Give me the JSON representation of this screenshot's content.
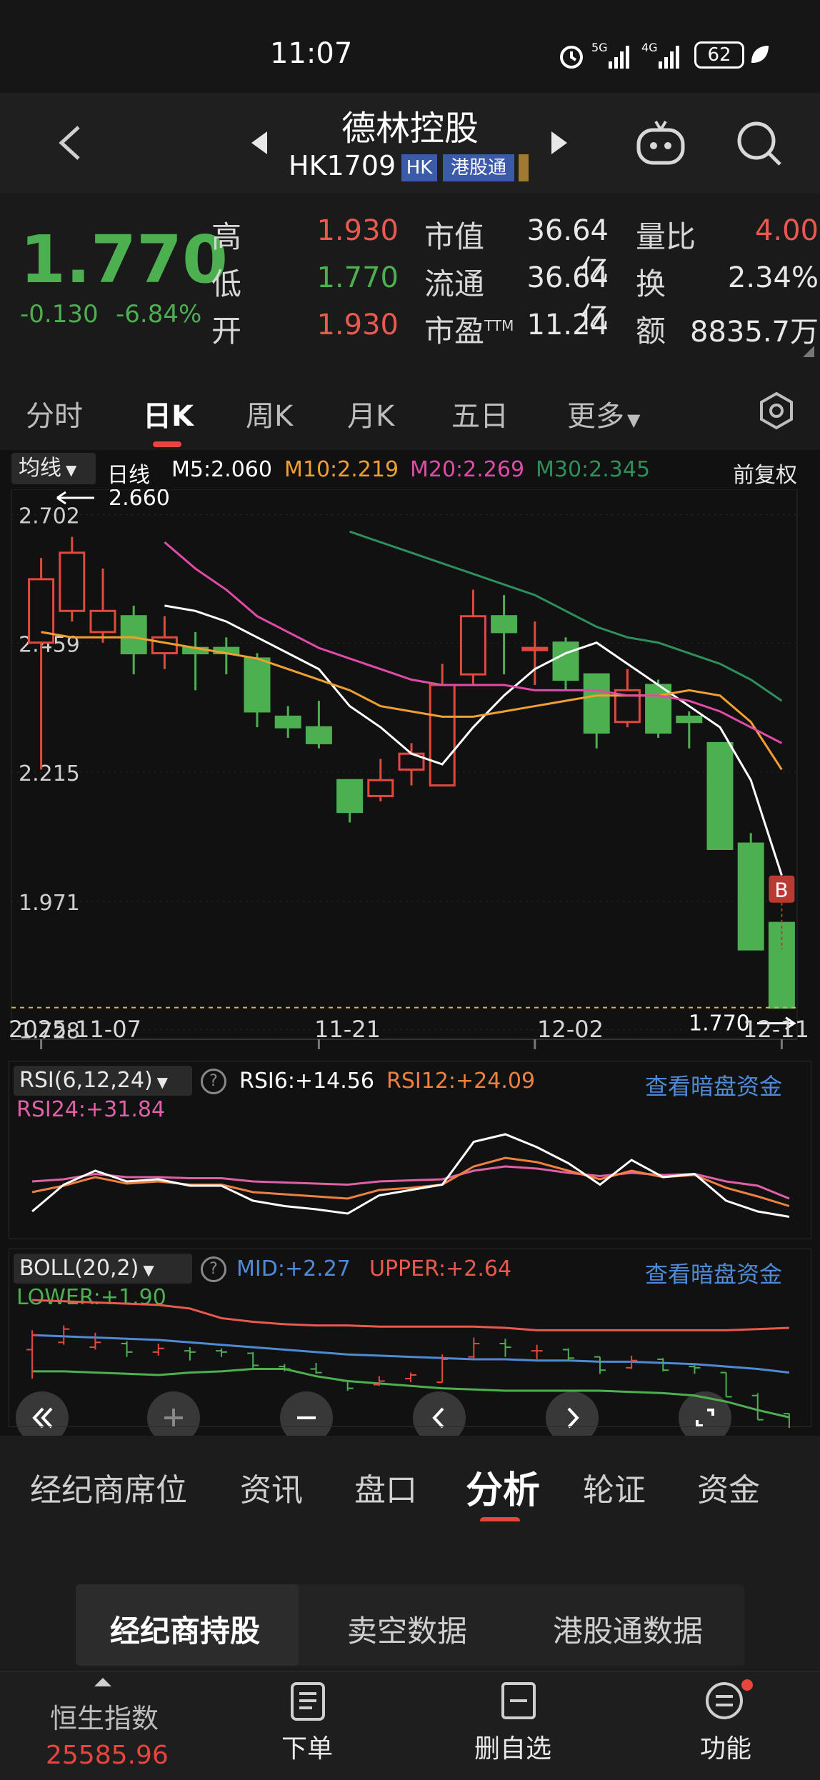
{
  "status": {
    "time": "11:07",
    "battery": "62",
    "net1": "5G",
    "net2": "4G"
  },
  "header": {
    "name": "德林控股",
    "code": "HK1709",
    "badge_hk": "HK",
    "badge_connect": "港股通"
  },
  "quote": {
    "price": "1.770",
    "change": "-0.130",
    "change_pct": "-6.84%",
    "high_label": "高",
    "high": "1.930",
    "low_label": "低",
    "low": "1.770",
    "open_label": "开",
    "open": "1.930",
    "mcap_label": "市值",
    "mcap": "36.64亿",
    "float_label": "流通",
    "float": "36.64亿",
    "pe_label": "市盈",
    "pe_sup": "TTM",
    "pe": "11.24",
    "vr_label": "量比",
    "vr": "4.00",
    "turnover_label": "换",
    "turnover": "2.34%",
    "amount_label": "额",
    "amount": "8835.7万"
  },
  "tabs": {
    "t1": "分时",
    "t2": "日K",
    "t3": "周K",
    "t4": "月K",
    "t5": "五日",
    "t6": "更多"
  },
  "ma_bar": {
    "select": "均线",
    "period": "日线",
    "m5": "M5:2.060",
    "m10": "M10:2.219",
    "m20": "M20:2.269",
    "m30": "M30:2.345",
    "adjust": "前复权"
  },
  "kline": {
    "y_ticks": [
      "2.702",
      "2.459",
      "2.215",
      "1.971",
      "1.728"
    ],
    "y_values": [
      2.702,
      2.459,
      2.215,
      1.971,
      1.728
    ],
    "max_label": "2.660",
    "last_label": "1.770",
    "x_labels": [
      "2025-11-07",
      "11-21",
      "12-02",
      "12-11"
    ],
    "buy_marker": "B",
    "candles": [
      {
        "o": 2.46,
        "c": 2.58,
        "h": 2.62,
        "l": 2.22
      },
      {
        "o": 2.52,
        "c": 2.63,
        "h": 2.66,
        "l": 2.5
      },
      {
        "o": 2.48,
        "c": 2.52,
        "h": 2.6,
        "l": 2.46
      },
      {
        "o": 2.51,
        "c": 2.44,
        "h": 2.53,
        "l": 2.4
      },
      {
        "o": 2.44,
        "c": 2.47,
        "h": 2.51,
        "l": 2.41
      },
      {
        "o": 2.45,
        "c": 2.44,
        "h": 2.48,
        "l": 2.37
      },
      {
        "o": 2.45,
        "c": 2.44,
        "h": 2.47,
        "l": 2.4
      },
      {
        "o": 2.43,
        "c": 2.33,
        "h": 2.44,
        "l": 2.3
      },
      {
        "o": 2.32,
        "c": 2.3,
        "h": 2.34,
        "l": 2.28
      },
      {
        "o": 2.3,
        "c": 2.27,
        "h": 2.35,
        "l": 2.26
      },
      {
        "o": 2.2,
        "c": 2.14,
        "h": 2.2,
        "l": 2.12
      },
      {
        "o": 2.17,
        "c": 2.2,
        "h": 2.24,
        "l": 2.16
      },
      {
        "o": 2.22,
        "c": 2.25,
        "h": 2.27,
        "l": 2.19
      },
      {
        "o": 2.19,
        "c": 2.38,
        "h": 2.42,
        "l": 2.19
      },
      {
        "o": 2.4,
        "c": 2.51,
        "h": 2.56,
        "l": 2.38
      },
      {
        "o": 2.51,
        "c": 2.48,
        "h": 2.55,
        "l": 2.4
      },
      {
        "o": 2.45,
        "c": 2.45,
        "h": 2.5,
        "l": 2.38
      },
      {
        "o": 2.46,
        "c": 2.39,
        "h": 2.47,
        "l": 2.37
      },
      {
        "o": 2.4,
        "c": 2.29,
        "h": 2.4,
        "l": 2.26
      },
      {
        "o": 2.31,
        "c": 2.37,
        "h": 2.41,
        "l": 2.3
      },
      {
        "o": 2.38,
        "c": 2.29,
        "h": 2.39,
        "l": 2.28
      },
      {
        "o": 2.32,
        "c": 2.31,
        "h": 2.33,
        "l": 2.26
      },
      {
        "o": 2.27,
        "c": 2.07,
        "h": 2.27,
        "l": 2.07
      },
      {
        "o": 2.08,
        "c": 1.88,
        "h": 2.1,
        "l": 1.88
      },
      {
        "o": 1.93,
        "c": 1.77,
        "h": 1.93,
        "l": 1.77
      }
    ],
    "ma5": [
      null,
      null,
      null,
      null,
      2.53,
      2.52,
      2.5,
      2.47,
      2.44,
      2.41,
      2.34,
      2.3,
      2.25,
      2.23,
      2.3,
      2.36,
      2.41,
      2.44,
      2.46,
      2.42,
      2.38,
      2.34,
      2.3,
      2.2,
      2.02
    ],
    "ma10": [
      2.48,
      2.47,
      2.47,
      2.47,
      2.46,
      2.45,
      2.44,
      2.43,
      2.41,
      2.39,
      2.37,
      2.34,
      2.33,
      2.32,
      2.32,
      2.33,
      2.34,
      2.35,
      2.36,
      2.36,
      2.36,
      2.37,
      2.36,
      2.31,
      2.22
    ],
    "ma20": [
      null,
      null,
      null,
      null,
      2.65,
      2.6,
      2.56,
      2.51,
      2.48,
      2.45,
      2.43,
      2.41,
      2.39,
      2.38,
      2.38,
      2.38,
      2.37,
      2.37,
      2.37,
      2.36,
      2.36,
      2.35,
      2.33,
      2.3,
      2.27
    ],
    "ma30": [
      null,
      null,
      null,
      null,
      null,
      null,
      null,
      null,
      null,
      null,
      2.67,
      2.65,
      2.63,
      2.61,
      2.59,
      2.57,
      2.55,
      2.52,
      2.49,
      2.47,
      2.46,
      2.44,
      2.42,
      2.39,
      2.35
    ]
  },
  "rsi": {
    "select": "RSI(6,12,24)",
    "rsi6": "RSI6:+14.56",
    "rsi12": "RSI12:+24.09",
    "rsi24": "RSI24:+31.84",
    "link": "查看暗盘资金",
    "r6": [
      20,
      45,
      58,
      48,
      50,
      44,
      44,
      30,
      25,
      22,
      18,
      35,
      40,
      45,
      85,
      92,
      80,
      65,
      45,
      68,
      52,
      55,
      30,
      20,
      15
    ],
    "r12": [
      38,
      44,
      52,
      46,
      48,
      45,
      45,
      38,
      36,
      34,
      32,
      40,
      42,
      45,
      62,
      70,
      66,
      58,
      50,
      58,
      52,
      54,
      42,
      34,
      25
    ],
    "r24": [
      48,
      50,
      55,
      52,
      52,
      51,
      51,
      48,
      47,
      46,
      45,
      48,
      49,
      50,
      58,
      62,
      60,
      56,
      53,
      56,
      54,
      55,
      48,
      44,
      32
    ]
  },
  "boll": {
    "select": "BOLL(20,2)",
    "mid": "MID:+2.27",
    "upper": "UPPER:+2.64",
    "lower": "LOWER:+1.90",
    "link": "查看暗盘资金",
    "upper_s": [
      2.87,
      2.86,
      2.85,
      2.84,
      2.83,
      2.8,
      2.72,
      2.69,
      2.67,
      2.66,
      2.66,
      2.65,
      2.65,
      2.65,
      2.65,
      2.64,
      2.62,
      2.62,
      2.62,
      2.62,
      2.62,
      2.62,
      2.62,
      2.63,
      2.64
    ],
    "mid_s": [
      2.58,
      2.57,
      2.56,
      2.55,
      2.54,
      2.52,
      2.5,
      2.48,
      2.46,
      2.44,
      2.42,
      2.41,
      2.4,
      2.39,
      2.38,
      2.38,
      2.37,
      2.37,
      2.36,
      2.36,
      2.35,
      2.34,
      2.32,
      2.3,
      2.27
    ],
    "lower_s": [
      2.28,
      2.28,
      2.27,
      2.26,
      2.25,
      2.27,
      2.28,
      2.3,
      2.3,
      2.24,
      2.2,
      2.18,
      2.16,
      2.14,
      2.13,
      2.12,
      2.12,
      2.12,
      2.12,
      2.11,
      2.1,
      2.08,
      2.03,
      1.96,
      1.9
    ]
  },
  "bottom_tabs": {
    "b1": "经纪商席位",
    "b2": "资讯",
    "b3": "盘口",
    "b4": "分析",
    "b5": "轮证",
    "b6": "资金"
  },
  "sub_tabs": {
    "s1": "经纪商持股",
    "s2": "卖空数据",
    "s3": "港股通数据"
  },
  "footer": {
    "index_name": "恒生指数",
    "index_value": "25585.96",
    "f2": "下单",
    "f3": "删自选",
    "f4": "功能"
  }
}
